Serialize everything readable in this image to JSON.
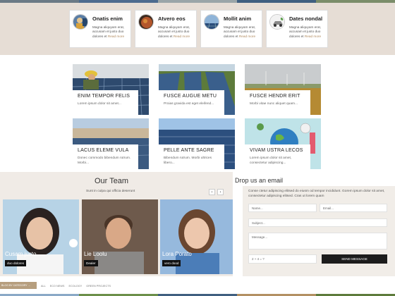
{
  "features": [
    {
      "title": "Onatis enim",
      "desc": "Magna aliquyam erat, accusam et justo duo dolores et",
      "more": "Read more"
    },
    {
      "title": "Atvero eos",
      "desc": "Magna aliquyam erat, accusam et justo duo dolores et",
      "more": "Read more"
    },
    {
      "title": "Mollit anim",
      "desc": "Magna aliquyam erat, accusam et justo duo dolores et",
      "more": "Read more"
    },
    {
      "title": "Dates nondal",
      "desc": "Magna aliquyam erat, accusam et justo duo dolores et",
      "more": "Read more"
    }
  ],
  "posts": [
    {
      "title": "ENIM TEMPOR FELIS",
      "desc": "Lorem ipsum dolor sit amet..."
    },
    {
      "title": "FUSCE AUGUE METU",
      "desc": "Proias gravida est eget eleifend..."
    },
    {
      "title": "FUSCE HENDR ERIT",
      "desc": "Morbi vitae nunc aliquet quam..."
    },
    {
      "title": "LACUS ELEME VULA",
      "desc": "Donec commodo bibendum rutrum. Morbi..."
    },
    {
      "title": "PELLE ANTE SAGRE",
      "desc": "Bibendum rutrum. Morbi ultrices libero..."
    },
    {
      "title": "VIVAM USTRA LECOS",
      "desc": "Lorem ipsum dolor sit amet, consectetur adipiscing..."
    }
  ],
  "team": {
    "title": "Our Team",
    "subtitle": "Sunt in culpa qui officia deserunt",
    "prev": "‹",
    "next": "›",
    "members": [
      {
        "name": "Cusam justo",
        "role": "duo dolores"
      },
      {
        "name": "Lie Loolu",
        "role": "Dealer"
      },
      {
        "name": "Lora Porato",
        "role": "vero dood"
      }
    ]
  },
  "contact": {
    "title": "Drop us an email",
    "intro": "Conse ctetur adipiscing elitsed do eiusm od tempor incididunt. Gorem ipsum dolor sit amet, consectetur adipiscing elitsed. Cras ut lorem quam",
    "name_placeholder": "Name...",
    "email_placeholder": "Email...",
    "subject_placeholder": "Subject...",
    "message_placeholder": "Message...",
    "captcha": "2 + 4 = ?",
    "send_label": "SEND MESSAGE"
  },
  "footer": {
    "category_label": "BLOG BY CATEGORY →",
    "tags": [
      "ALL",
      "ECO NEWS",
      "ECOLOGY",
      "GREEN PROJECTS"
    ]
  },
  "colors": {
    "band": "#e6ddd5",
    "team_bg": "#f0ebe6",
    "accent": "#b08a5e",
    "button": "#1c1c1c",
    "category": "#b69e7e"
  }
}
